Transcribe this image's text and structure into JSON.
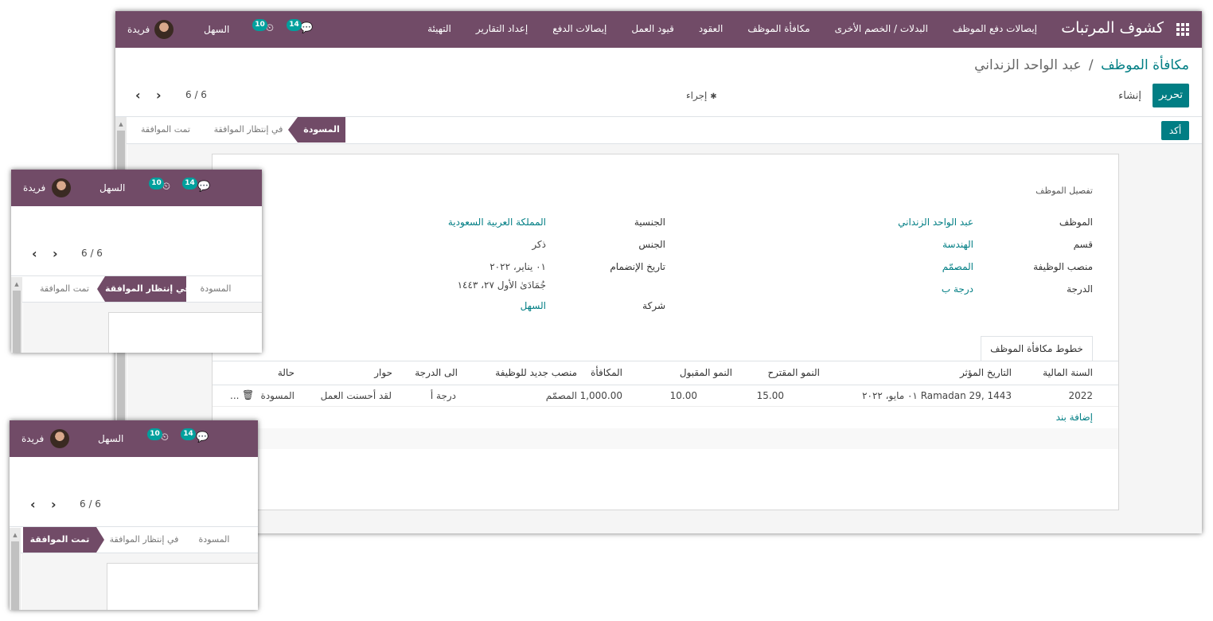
{
  "navbar": {
    "brand": "كشوف المرتبات",
    "menu": [
      "إيصالات دفع الموظف",
      "البدلات / الخصم الأخرى",
      "مكافأة الموظف",
      "العقود",
      "قيود العمل",
      "إيصالات الدفع",
      "إعداد التقارير",
      "التهيئة"
    ],
    "company": "السهل",
    "user": "فريدة",
    "messages_count": "14",
    "activities_count": "10"
  },
  "breadcrumb": {
    "parent": "مكافأة الموظف",
    "separator": "/",
    "current": "عبد الواحد الزنداني"
  },
  "buttons": {
    "edit": "تحرير",
    "create": "إنشاء",
    "action": "إجراء",
    "confirm": "أكد"
  },
  "pager": {
    "value": "6 / 6"
  },
  "stages": {
    "draft": "المسودة",
    "waiting": "في إنتظار الموافقة",
    "approved": "تمت الموافقة"
  },
  "form": {
    "section_title": "تفصيل الموظف",
    "employee_label": "الموظف",
    "employee": "عبد الواحد الزنداني",
    "department_label": "قسم",
    "department": "الهندسة",
    "job_label": "منصب الوظيفة",
    "job": "المصمّم",
    "grade_label": "الدرجة",
    "grade": "درجة ب",
    "nationality_label": "الجنسية",
    "nationality": "المملكة العربية السعودية",
    "gender_label": "الجنس",
    "gender": "ذكر",
    "join_label": "تاريخ الإنضمام",
    "join_date": "٠١ يناير، ٢٠٢٢",
    "join_hijri": "جُمَادَىٰ الأول ٢٧، ١٤٤٣",
    "company_label": "شركة",
    "company": "السهل"
  },
  "tab": {
    "label": "خطوط مكافأة الموظف"
  },
  "table": {
    "headers": {
      "year": "السنة المالية",
      "date": "التاريخ المؤثر",
      "proposed": "النمو المقترح",
      "accepted": "النمو المقبول",
      "reward": "المكافأة",
      "new_job": "منصب جديد للوظيفة",
      "to_grade": "الى الدرجة",
      "dialog": "حوار",
      "state": "حالة"
    },
    "row": {
      "year": "2022",
      "date": "٠١ مايو، ٢٠٢٢ Ramadan 29, 1443",
      "proposed": "15.00",
      "accepted": "10.00",
      "reward": "1,000.00",
      "new_job": "المصمّم",
      "to_grade": "درجة أ",
      "dialog": "لقد أحسنت العمل",
      "state": "المسودة",
      "more": "..."
    },
    "add_line": "إضافة بند"
  }
}
